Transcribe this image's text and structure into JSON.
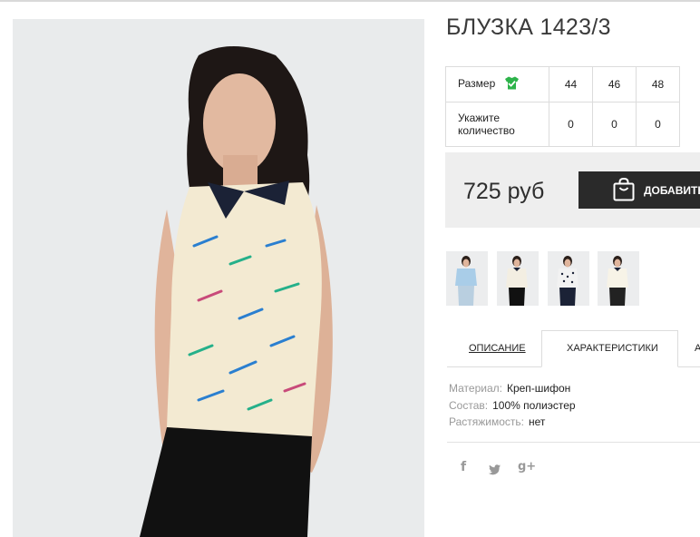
{
  "product": {
    "title": "БЛУЗКА 1423/3"
  },
  "sizes": {
    "size_label": "Размер",
    "qty_label": "Укажите количество",
    "columns": [
      "44",
      "46",
      "48"
    ],
    "quantities": [
      "0",
      "0",
      "0"
    ],
    "check_color": "#2db34a"
  },
  "price": {
    "value": "725 руб",
    "add_button_label": "ДОБАВИТЬ"
  },
  "thumbnails": [
    {
      "name": "thumb-blue-blouse"
    },
    {
      "name": "thumb-white-print-blouse"
    },
    {
      "name": "thumb-dot-blouse"
    },
    {
      "name": "thumb-light-blouse"
    }
  ],
  "tabs": {
    "description": "ОПИСАНИЕ",
    "characteristics": "ХАРАКТЕРИСТИКИ",
    "third": "А"
  },
  "characteristics": [
    {
      "key": "Материал:",
      "value": "Креп-шифон"
    },
    {
      "key": "Состав:",
      "value": "100% полиэстер"
    },
    {
      "key": "Растяжимость:",
      "value": "нет"
    }
  ],
  "social": {
    "facebook": "f",
    "twitter": "t",
    "googleplus": "g+"
  },
  "colors": {
    "accent_button": "#2a2a2a",
    "price_bg": "#eeeeee"
  }
}
